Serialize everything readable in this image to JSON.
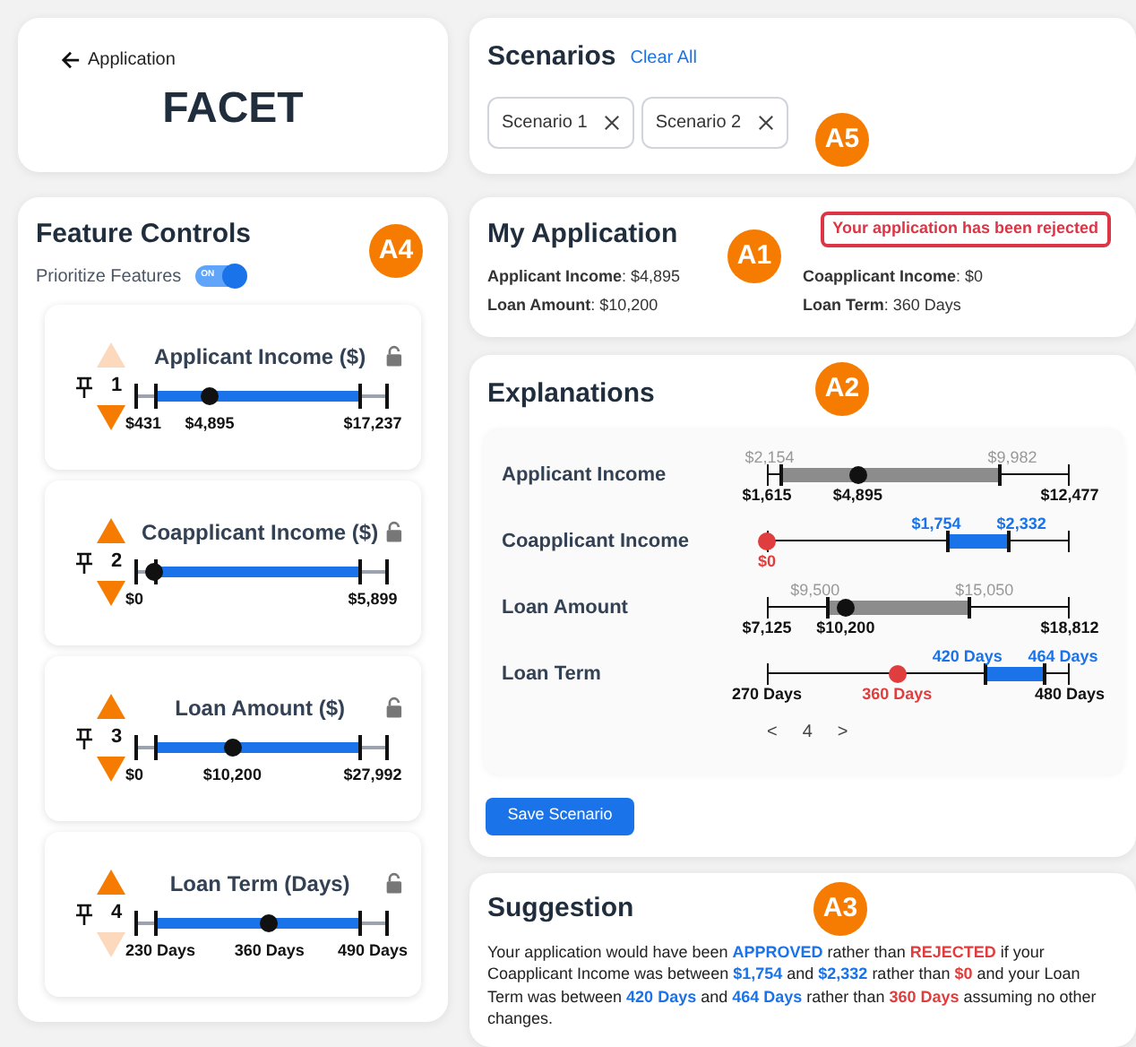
{
  "header": {
    "back_label": "Application",
    "title": "FACET"
  },
  "scenarios": {
    "title": "Scenarios",
    "clear_label": "Clear All",
    "badge": "A5",
    "items": [
      {
        "label": "Scenario 1"
      },
      {
        "label": "Scenario 2"
      }
    ]
  },
  "feature_controls": {
    "title": "Feature Controls",
    "badge": "A4",
    "toggle": {
      "label": "Prioritize Features",
      "switch_text": "ON",
      "on": true
    },
    "features": [
      {
        "title": "Applicant Income ($)",
        "rank": "1",
        "up_enabled": false,
        "down_enabled": true,
        "locked": false,
        "slider": {
          "min": "$431",
          "max": "$17,237",
          "value": "$4,895",
          "level": 0.27
        }
      },
      {
        "title": "Coapplicant Income ($)",
        "rank": "2",
        "up_enabled": true,
        "down_enabled": true,
        "locked": false,
        "slider": {
          "min": "$0",
          "max": "$5,899",
          "level": 0
        }
      },
      {
        "title": "Loan Amount ($)",
        "rank": "3",
        "up_enabled": true,
        "down_enabled": true,
        "locked": false,
        "slider": {
          "min": "$0",
          "max": "$27,992",
          "value": "$10,200",
          "level": 0.38
        }
      },
      {
        "title": "Loan Term (Days)",
        "rank": "4",
        "up_enabled": true,
        "down_enabled": false,
        "locked": false,
        "slider": {
          "min": "230 Days",
          "max": "490 Days",
          "value": "360 Days",
          "level": 0.56
        }
      }
    ]
  },
  "application": {
    "title": "My Application",
    "badge": "A1",
    "status": {
      "kind": "rejected",
      "text": "Your application has been rejected"
    },
    "fields": [
      "**Applicant Income**: $4,895",
      "**Coapplicant Income**: $0",
      "**Loan Amount**: $10,200",
      "**Loan Term**: 360 Days"
    ]
  },
  "explanations": {
    "title": "Explanations",
    "badge": "A2",
    "rows": [
      {
        "label": "Applicant Income",
        "min": "$1,615",
        "max": "$12,477",
        "band": {
          "kind": "allowed",
          "start": {
            "label": "$2,154",
            "level": 0.05
          },
          "end": {
            "label": "$9,982",
            "level": 0.77
          }
        },
        "current": {
          "kind": "inside",
          "label": "$4,895",
          "level": 0.3
        }
      },
      {
        "label": "Coapplicant Income",
        "band": {
          "kind": "suggested",
          "start": {
            "label": "$1,754",
            "level": 0.6
          },
          "end": {
            "label": "$2,332",
            "level": 0.8
          }
        },
        "current": {
          "kind": "outside",
          "label": "$0",
          "level": 0
        }
      },
      {
        "label": "Loan Amount",
        "min": "$7,125",
        "max": "$18,812",
        "band": {
          "kind": "allowed",
          "start": {
            "label": "$9,500",
            "level": 0.2
          },
          "end": {
            "label": "$15,050",
            "level": 0.67
          }
        },
        "current": {
          "kind": "inside",
          "label": "$10,200",
          "level": 0.26
        }
      },
      {
        "label": "Loan Term",
        "min": "270 Days",
        "max": "480 Days",
        "band": {
          "kind": "suggested",
          "start": {
            "label": "420 Days",
            "level": 0.72
          },
          "end": {
            "label": "464 Days",
            "level": 0.92
          }
        },
        "current": {
          "kind": "outside",
          "label": "360 Days",
          "level": 0.43
        }
      }
    ],
    "pager": {
      "prev": "<",
      "page": "4",
      "next": ">"
    },
    "save_label": "Save Scenario"
  },
  "suggestion": {
    "title": "Suggestion",
    "badge": "A3",
    "segments": [
      {
        "kind": "plain",
        "text": "Your application would have been "
      },
      {
        "kind": "good",
        "text": "APPROVED"
      },
      {
        "kind": "plain",
        "text": " rather than "
      },
      {
        "kind": "bad",
        "text": "REJECTED"
      },
      {
        "kind": "plain",
        "text": " if your Coapplicant Income was between "
      },
      {
        "kind": "good",
        "text": "$1,754"
      },
      {
        "kind": "plain",
        "text": " and "
      },
      {
        "kind": "good",
        "text": "$2,332"
      },
      {
        "kind": "plain",
        "text": " rather than "
      },
      {
        "kind": "bad",
        "text": "$0"
      },
      {
        "kind": "plain",
        "text": " and your Loan Term was between "
      },
      {
        "kind": "good",
        "text": "420 Days"
      },
      {
        "kind": "plain",
        "text": " and "
      },
      {
        "kind": "good",
        "text": "464 Days"
      },
      {
        "kind": "plain",
        "text": " rather than "
      },
      {
        "kind": "bad",
        "text": "360 Days"
      },
      {
        "kind": "plain",
        "text": " assuming no other changes."
      }
    ]
  }
}
